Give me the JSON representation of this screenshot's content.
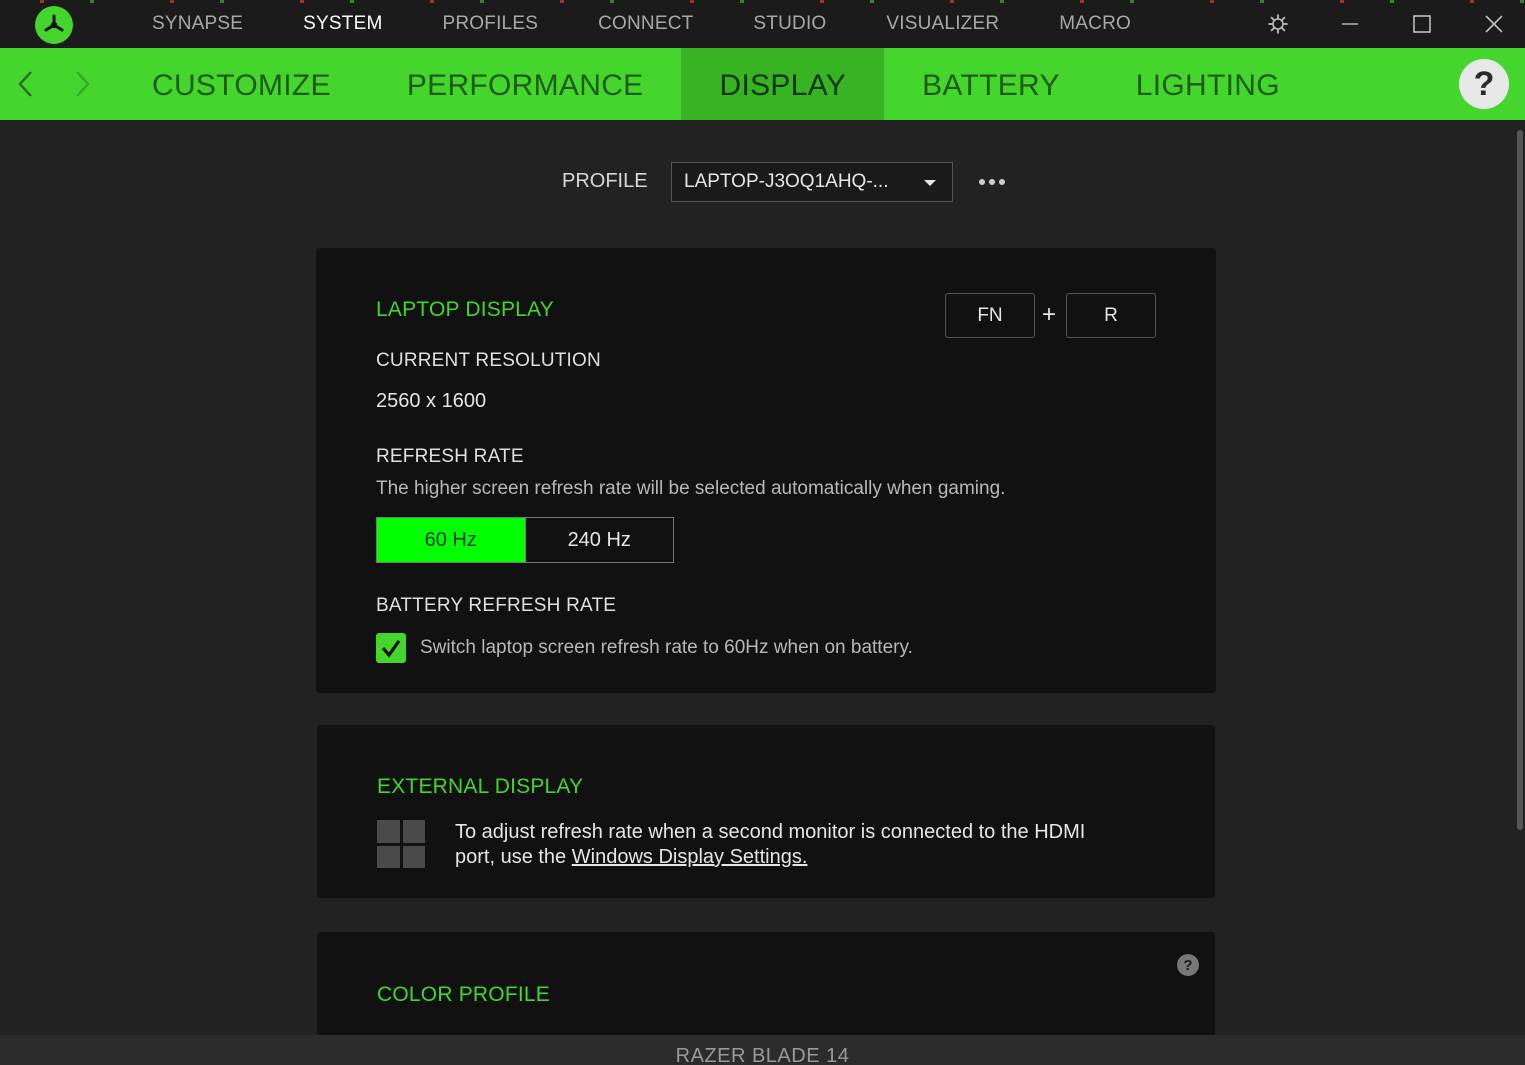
{
  "topnav": {
    "items": [
      {
        "label": "SYNAPSE",
        "active": false
      },
      {
        "label": "SYSTEM",
        "active": true
      },
      {
        "label": "PROFILES",
        "active": false
      },
      {
        "label": "CONNECT",
        "active": false
      },
      {
        "label": "STUDIO",
        "active": false
      },
      {
        "label": "VISUALIZER",
        "active": false
      },
      {
        "label": "MACRO",
        "active": false
      }
    ],
    "window_icons": [
      "settings-icon",
      "minimize-icon",
      "maximize-icon",
      "close-icon"
    ]
  },
  "subnav": {
    "items": [
      {
        "label": "CUSTOMIZE",
        "active": false
      },
      {
        "label": "PERFORMANCE",
        "active": false
      },
      {
        "label": "DISPLAY",
        "active": true
      },
      {
        "label": "BATTERY",
        "active": false
      },
      {
        "label": "LIGHTING",
        "active": false
      }
    ],
    "help_label": "?"
  },
  "profile": {
    "label": "PROFILE",
    "selected": "LAPTOP-J3OQ1AHQ-..."
  },
  "laptop_display": {
    "title": "LAPTOP DISPLAY",
    "shortcut": {
      "key1": "FN",
      "plus": "+",
      "key2": "R"
    },
    "current_resolution_label": "CURRENT RESOLUTION",
    "current_resolution_value": "2560 x 1600",
    "refresh_rate_label": "REFRESH RATE",
    "refresh_rate_desc": "The higher screen refresh rate will be selected automatically when gaming.",
    "refresh_options": [
      {
        "label": "60 Hz",
        "selected": true
      },
      {
        "label": "240 Hz",
        "selected": false
      }
    ],
    "battery_refresh_label": "BATTERY REFRESH RATE",
    "battery_refresh_checked": true,
    "battery_refresh_desc": "Switch laptop screen refresh rate to 60Hz when on battery."
  },
  "external_display": {
    "title": "EXTERNAL DISPLAY",
    "desc_line1": "To adjust refresh rate when a second monitor is connected to the HDMI",
    "desc_line2_prefix": "port, use the ",
    "desc_link": "Windows Display Settings."
  },
  "color_profile": {
    "title": "COLOR PROFILE",
    "help_label": "?"
  },
  "footer": {
    "device_name": "RAZER BLADE 14"
  },
  "colors": {
    "accent": "#44d62c",
    "selected_segment": "#00ff00",
    "background": "#222222",
    "card": "#111111"
  }
}
